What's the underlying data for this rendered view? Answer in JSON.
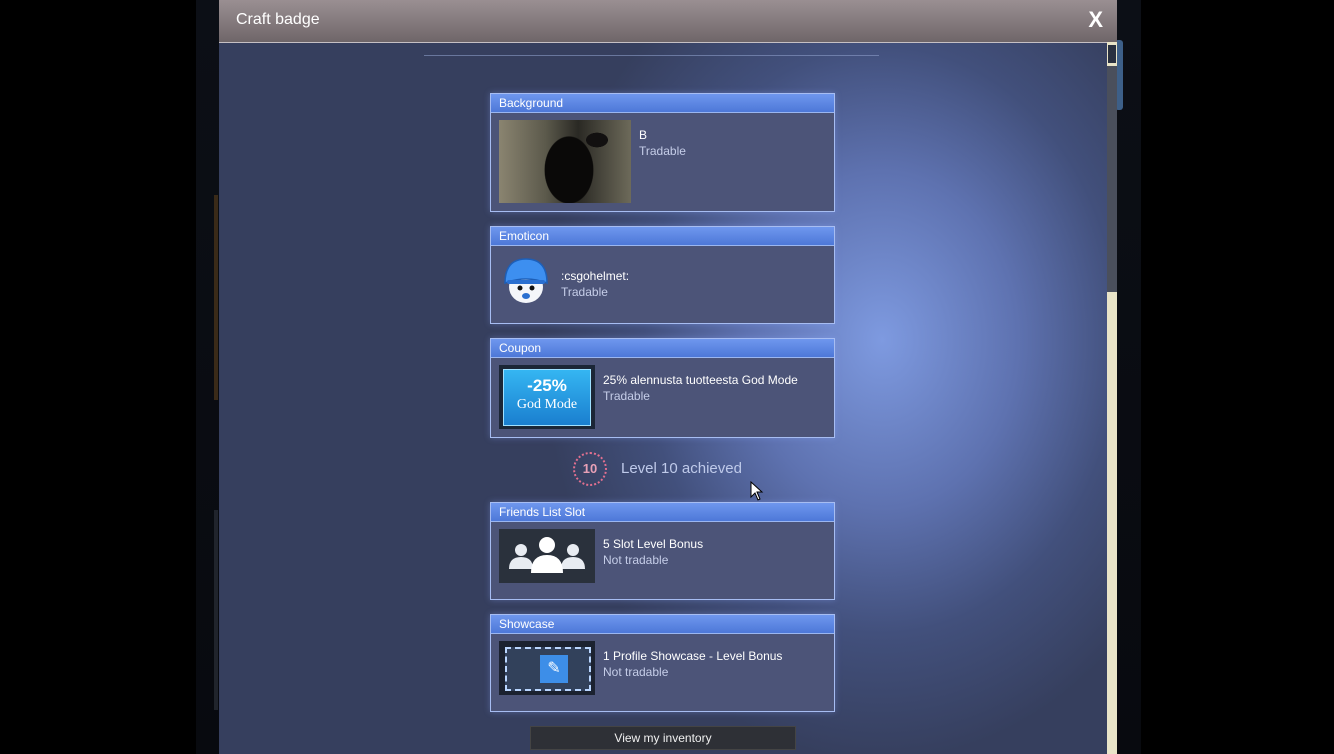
{
  "dialog": {
    "title": "Craft badge",
    "close_label": "X"
  },
  "items": {
    "background": {
      "category": "Background",
      "name": "B",
      "tradable": "Tradable"
    },
    "emoticon": {
      "category": "Emoticon",
      "name": ":csgohelmet:",
      "tradable": "Tradable"
    },
    "coupon": {
      "category": "Coupon",
      "name": "25% alennusta tuotteesta God Mode",
      "tradable": "Tradable",
      "badge_percent": "-25%",
      "badge_game": "God Mode"
    },
    "friends": {
      "category": "Friends List Slot",
      "name": "5 Slot Level Bonus",
      "tradable": "Not tradable"
    },
    "showcase": {
      "category": "Showcase",
      "name": "1 Profile Showcase - Level Bonus",
      "tradable": "Not tradable"
    }
  },
  "level": {
    "number": "10",
    "text": "Level 10 achieved"
  },
  "footer": {
    "inventory_button": "View my inventory"
  },
  "icons": {
    "close": "close-icon",
    "level": "level-ring-icon",
    "emoticon": "helmet-emoticon-icon",
    "friends": "friends-group-icon",
    "showcase": "pencil-icon"
  },
  "colors": {
    "card_header": "#5a84e0",
    "card_body": "#4c5478",
    "level_ring": "#e27090",
    "titlebar": "#857b7e"
  }
}
